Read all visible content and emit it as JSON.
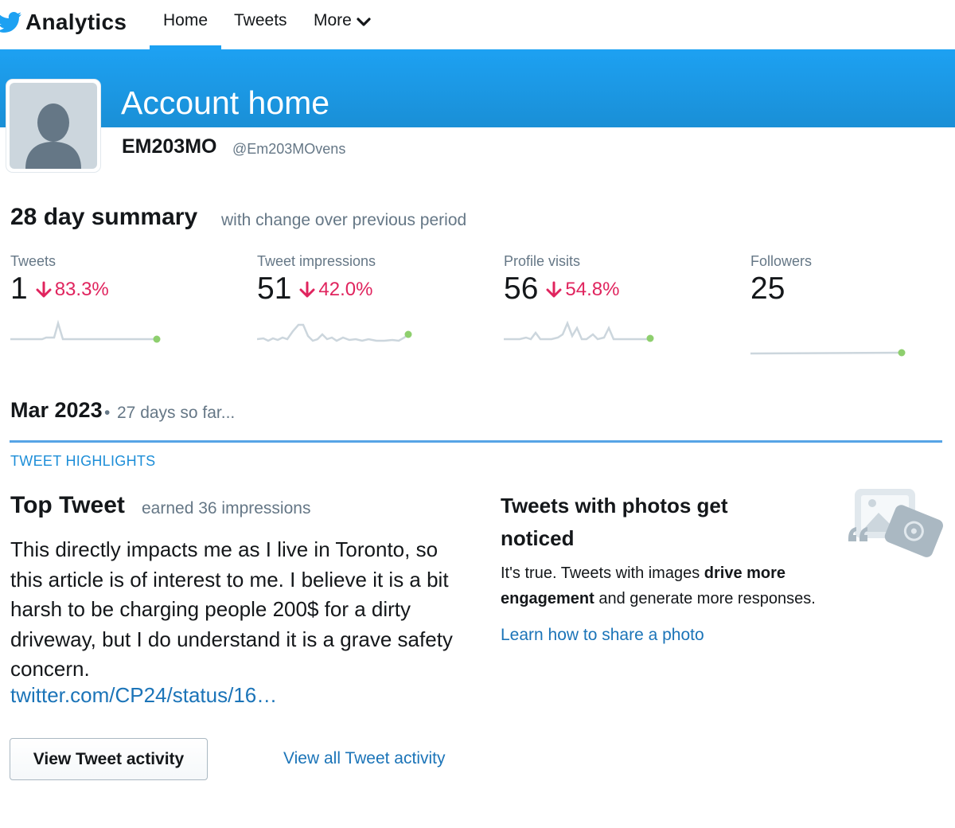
{
  "nav": {
    "brand": "Analytics",
    "home": "Home",
    "tweets": "Tweets",
    "more": "More"
  },
  "header": {
    "title": "Account home",
    "display_name": "EM203MO",
    "handle": "@Em203MOvens"
  },
  "summary": {
    "title": "28 day summary",
    "subtitle": "with change over previous period",
    "metrics": [
      {
        "label": "Tweets",
        "value": "1",
        "change": "83.3%",
        "direction": "down"
      },
      {
        "label": "Tweet impressions",
        "value": "51",
        "change": "42.0%",
        "direction": "down"
      },
      {
        "label": "Profile visits",
        "value": "56",
        "change": "54.8%",
        "direction": "down"
      },
      {
        "label": "Followers",
        "value": "25",
        "change": "",
        "direction": "none"
      }
    ]
  },
  "period": {
    "month": "Mar 2023",
    "separator": "•",
    "subtitle": "27 days so far...",
    "section_label": "TWEET HIGHLIGHTS"
  },
  "top_tweet": {
    "title": "Top Tweet",
    "subtitle": "earned 36 impressions",
    "text": "This directly impacts me as I live in Toronto, so this article is of interest to me. I believe it is a bit harsh to be charging people 200$ for a dirty driveway, but I do understand it is a grave safety concern.",
    "link": "twitter.com/CP24/status/16…",
    "button": "View Tweet activity",
    "all_link": "View all Tweet activity"
  },
  "photo_tip": {
    "title": "Tweets with photos get noticed",
    "body_start": "It's true. Tweets with images ",
    "body_bold": "drive more engagement",
    "body_end": " and generate more responses.",
    "link": "Learn how to share a photo"
  },
  "colors": {
    "brand_blue": "#1da1f2",
    "negative": "#e0245e",
    "link": "#1b74b8",
    "spark_line": "#ccd6dd",
    "spark_dot": "#8ecf6e"
  }
}
